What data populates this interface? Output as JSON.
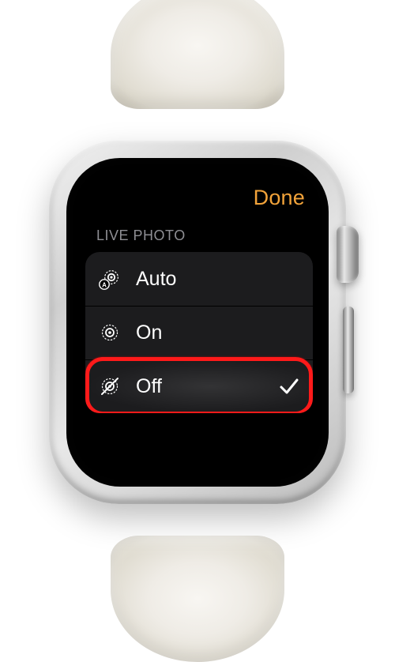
{
  "header": {
    "done_label": "Done"
  },
  "section": {
    "title": "LIVE PHOTO"
  },
  "options": {
    "auto": {
      "label": "Auto",
      "selected": false
    },
    "on": {
      "label": "On",
      "selected": false
    },
    "off": {
      "label": "Off",
      "selected": true
    }
  },
  "colors": {
    "accent": "#f2a33a",
    "highlight_border": "#ff1a1a"
  }
}
